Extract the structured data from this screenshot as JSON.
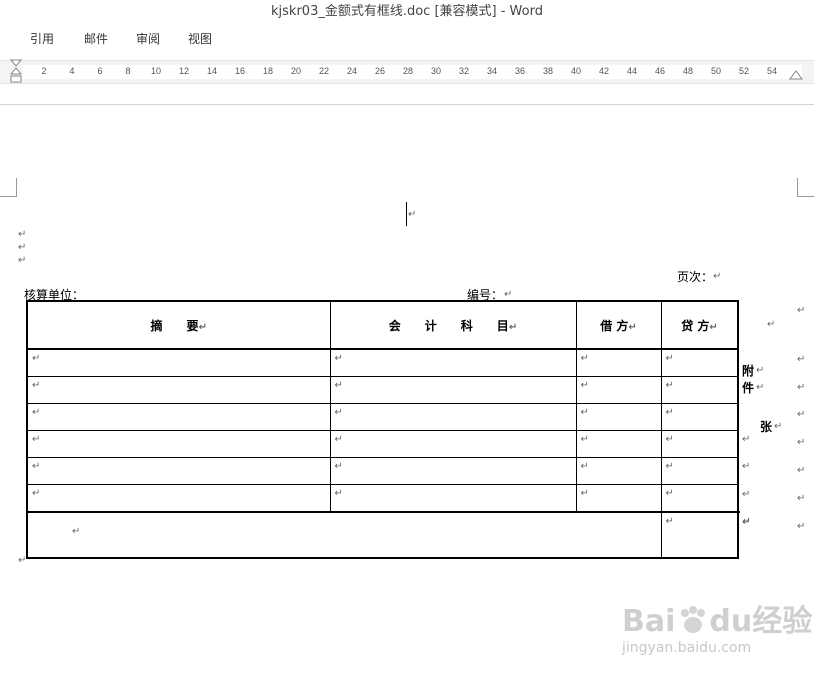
{
  "window": {
    "title": "kjskr03_金额式有框线.doc [兼容模式] - Word"
  },
  "menu": {
    "items": [
      "引用",
      "邮件",
      "审阅",
      "视图"
    ]
  },
  "ruler": {
    "numbers": [
      "2",
      "4",
      "6",
      "8",
      "10",
      "12",
      "14",
      "16",
      "18",
      "20",
      "22",
      "24",
      "26",
      "28",
      "30",
      "32",
      "34",
      "36",
      "38",
      "40",
      "42",
      "44",
      "46",
      "48",
      "50",
      "52",
      "54"
    ]
  },
  "document": {
    "paragraph_mark": "↵",
    "page_label": "页次：",
    "unit_label": "核算单位：",
    "number_label": "编号：",
    "table": {
      "headers": [
        "摘　　要",
        "会　　计　　科　　目",
        "借 方",
        "贷 方"
      ],
      "rows": 6
    },
    "side_labels": {
      "attach_1": "附",
      "attach_2": "件",
      "sheets": "张"
    }
  },
  "watermark": {
    "brand": "Bai",
    "brand_2": "du",
    "product": "经验",
    "url": "jingyan.baidu.com"
  }
}
